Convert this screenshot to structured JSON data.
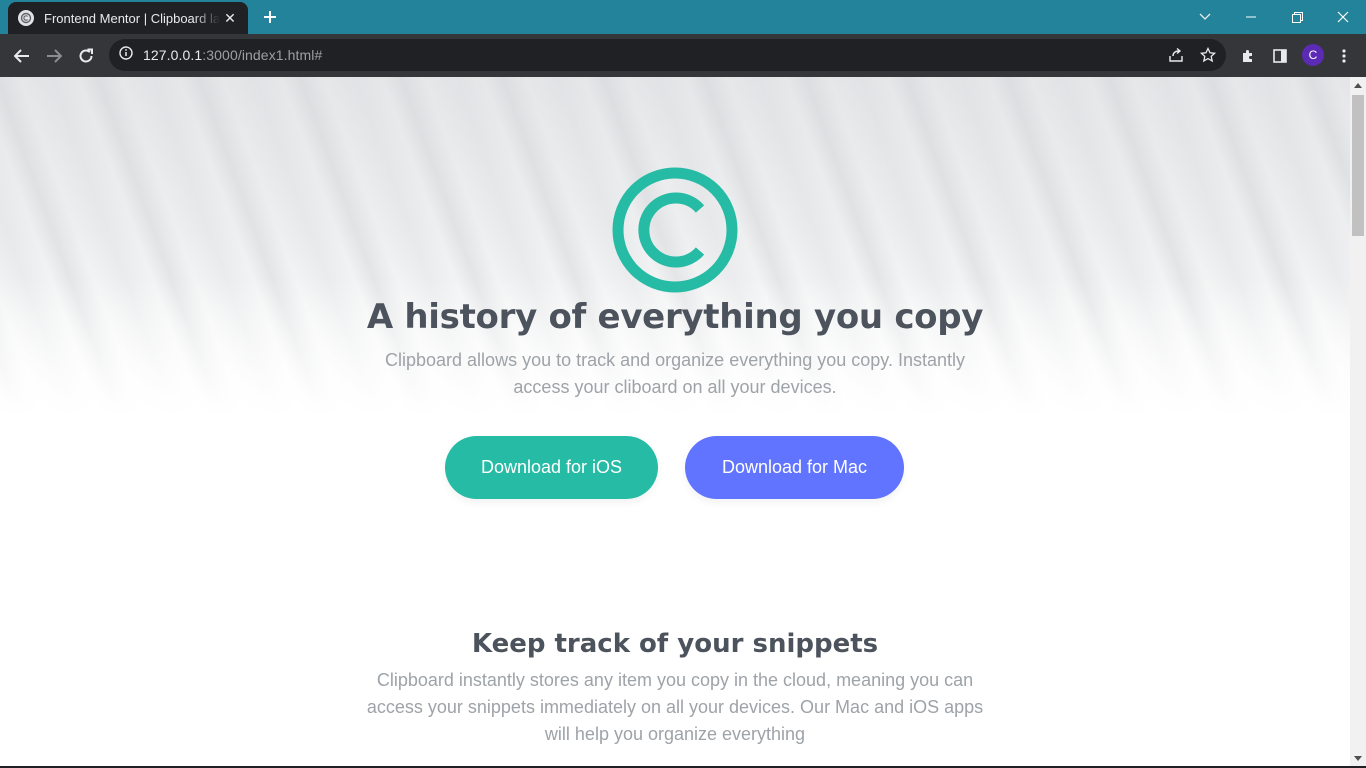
{
  "browser": {
    "tab_title": "Frontend Mentor | Clipboard landing page",
    "tab_close": "✕",
    "new_tab": "+",
    "url_host": "127.0.0.1",
    "url_rest": ":3000/index1.html#",
    "profile_initial": "C",
    "icons": [
      "back-arrow-icon",
      "forward-arrow-icon",
      "reload-icon",
      "site-info-icon",
      "share-icon",
      "bookmark-star-icon",
      "extensions-icon",
      "side-panel-icon",
      "kebab-menu-icon",
      "chevron-down-icon",
      "minimize-icon",
      "restore-icon",
      "close-icon"
    ]
  },
  "hero": {
    "title": "A history of everything you copy",
    "subtitle": "Clipboard allows you to track and organize everything you copy. Instantly access your cliboard on all your devices.",
    "btn_ios": "Download for iOS",
    "btn_mac": "Download for Mac"
  },
  "snippets": {
    "title": "Keep track of your snippets",
    "text": "Clipboard instantly stores any item you copy in the cloud, meaning you can access your snippets immediately on all your devices. Our Mac and iOS apps will help you organize everything"
  },
  "colors": {
    "brand_teal": "#26bba5",
    "brand_blue": "#6174ff",
    "heading": "#4c535c",
    "body_text": "#9ea3a8",
    "tabbar": "#23839a"
  }
}
